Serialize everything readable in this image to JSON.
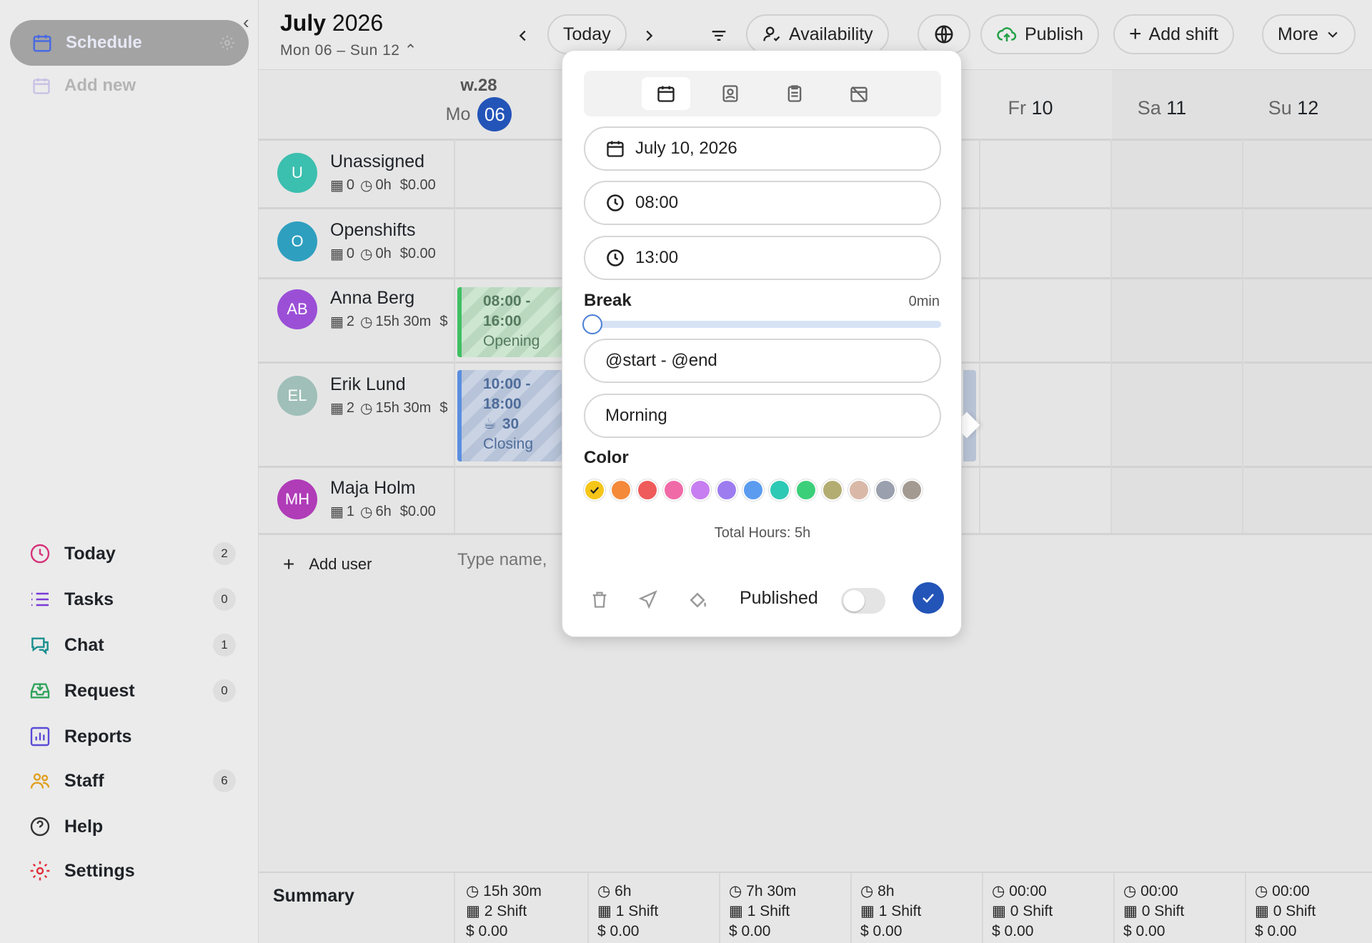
{
  "sidebar": {
    "active_label": "Schedule",
    "add_new_label": "Add new",
    "nav": [
      {
        "label": "Today",
        "count": "2",
        "icon": "clock-icon",
        "color": "#d6337a"
      },
      {
        "label": "Tasks",
        "count": "0",
        "icon": "list-icon",
        "color": "#7a3ad6"
      },
      {
        "label": "Chat",
        "count": "1",
        "icon": "chat-icon",
        "color": "#1a8f8f"
      },
      {
        "label": "Request",
        "count": "0",
        "icon": "inbox-icon",
        "color": "#2fa35a"
      },
      {
        "label": "Reports",
        "count": "",
        "icon": "chart-icon",
        "color": "#5b4ad6"
      },
      {
        "label": "Staff",
        "count": "6",
        "icon": "users-icon",
        "color": "#e0a020"
      },
      {
        "label": "Help",
        "count": "",
        "icon": "help-icon",
        "color": "#333333"
      },
      {
        "label": "Settings",
        "count": "",
        "icon": "gear-icon",
        "color": "#e0303a"
      }
    ]
  },
  "header": {
    "month": "July",
    "year": "2026",
    "range": "Mon 06 – Sun 12",
    "today_label": "Today",
    "availability_label": "Availability",
    "publish_label": "Publish",
    "add_shift_label": "Add shift",
    "more_label": "More"
  },
  "grid": {
    "week_label": "w.28",
    "days": [
      {
        "dow": "Mo",
        "num": "06",
        "today": true
      },
      {
        "dow": "Fr",
        "num": "10"
      },
      {
        "dow": "Sa",
        "num": "11"
      },
      {
        "dow": "Su",
        "num": "12"
      }
    ],
    "users": [
      {
        "initials": "U",
        "name": "Unassigned",
        "shifts": "0",
        "hours": "0h",
        "cost": "$0.00",
        "color": "#3bbfae"
      },
      {
        "initials": "O",
        "name": "Openshifts",
        "shifts": "0",
        "hours": "0h",
        "cost": "$0.00",
        "color": "#2e9fbf"
      },
      {
        "initials": "AB",
        "name": "Anna Berg",
        "shifts": "2",
        "hours": "15h 30m",
        "cost": "$",
        "color": "#9b4fd6"
      },
      {
        "initials": "EL",
        "name": "Erik Lund",
        "shifts": "2",
        "hours": "15h 30m",
        "cost": "$",
        "color": "#9fbfb8"
      },
      {
        "initials": "MH",
        "name": "Maja Holm",
        "shifts": "1",
        "hours": "6h",
        "cost": "$0.00",
        "color": "#b03cb8"
      }
    ],
    "shift_anna": {
      "l1": "08:00 -",
      "l2": "16:00",
      "l3": "Opening"
    },
    "shift_erik": {
      "l1": "10:00 -",
      "l2": "18:00",
      "l3": "30",
      "l4": "Closing"
    },
    "add_user_label": "Add user",
    "type_name_placeholder": "Type name,"
  },
  "summary": {
    "label": "Summary",
    "cols": [
      {
        "hours": "15h 30m",
        "shifts": "2 Shift",
        "cost": "0.00"
      },
      {
        "hours": "6h",
        "shifts": "1 Shift",
        "cost": "0.00"
      },
      {
        "hours": "7h 30m",
        "shifts": "1 Shift",
        "cost": "0.00"
      },
      {
        "hours": "8h",
        "shifts": "1 Shift",
        "cost": "0.00"
      },
      {
        "hours": "00:00",
        "shifts": "0 Shift",
        "cost": "0.00"
      },
      {
        "hours": "00:00",
        "shifts": "0 Shift",
        "cost": "0.00"
      },
      {
        "hours": "00:00",
        "shifts": "0 Shift",
        "cost": "0.00"
      }
    ]
  },
  "popup": {
    "date": "July 10, 2026",
    "start": "08:00",
    "end": "13:00",
    "break_label": "Break",
    "break_value": "0min",
    "break_fraction": 0,
    "title_template": "@start - @end",
    "shift_name": "Morning",
    "color_label": "Color",
    "colors": [
      "#f5c518",
      "#f5893a",
      "#ef5a5a",
      "#f06aa8",
      "#c77ef0",
      "#9d7cf0",
      "#5b9cf0",
      "#2ec9b5",
      "#3ccf7a",
      "#b3ad72",
      "#d9b8a8",
      "#9aa0ad",
      "#a39a92"
    ],
    "selected_color": 0,
    "total_hours": "Total Hours: 5h",
    "published_label": "Published",
    "published": false
  }
}
